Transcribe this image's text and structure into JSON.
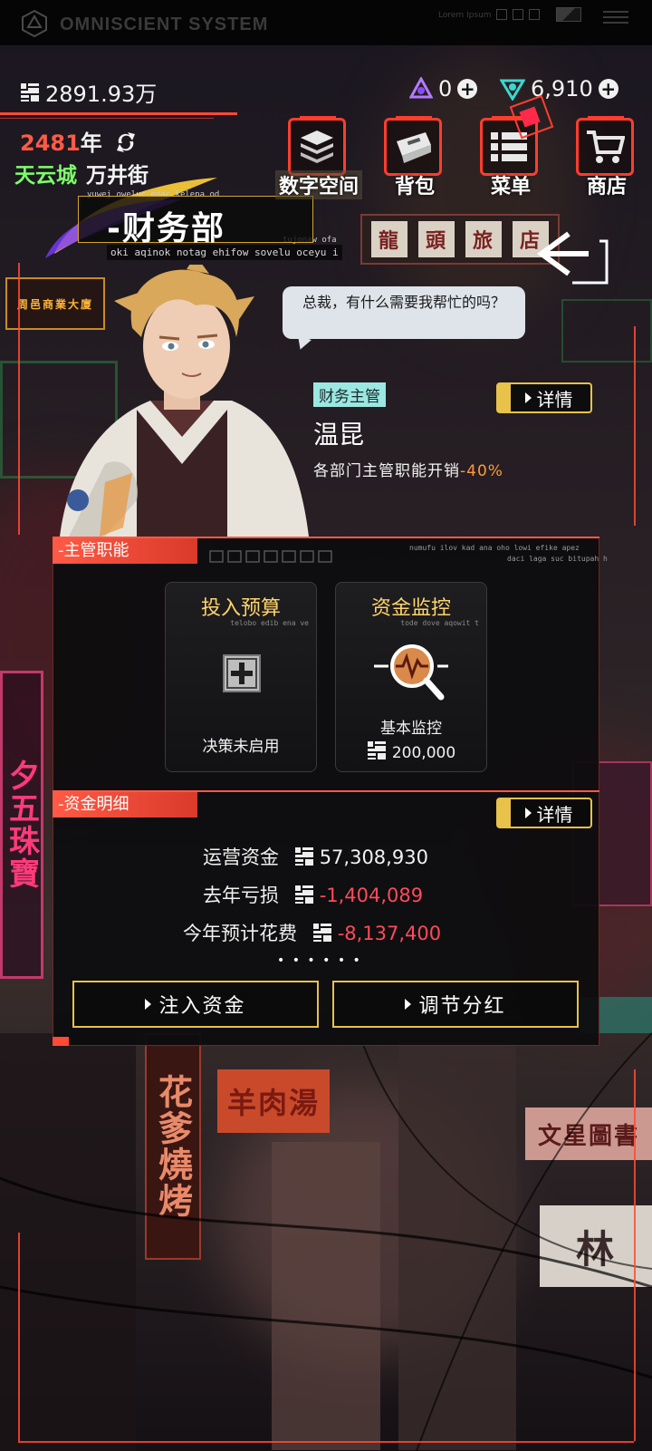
{
  "system": {
    "title": "OMNISCIENT SYSTEM",
    "lorem": "Lorem Ipsum"
  },
  "resources": {
    "money": "2891.93万",
    "gems_purple": "0",
    "gems_teal": "6,910"
  },
  "header": {
    "year_number": "2481",
    "year_unit": "年",
    "city": "天云城",
    "street": "万井街",
    "micro_top": "yuwej oweluc edac kelepa od",
    "micro_right": "tujonaw ofa",
    "department": "-财务部",
    "dept_sub": "oki aqinok notag ehifow sovelu oceyu i"
  },
  "menu": {
    "digital_space": "数字空间",
    "backpack": "背包",
    "menu": "菜单",
    "shop": "商店"
  },
  "signs": {
    "dragon": [
      "龍",
      "頭",
      "旅",
      "店"
    ],
    "mutton": "羊肉湯",
    "bookstore": "文星圖書",
    "bbq": "花爹燒烤",
    "left_vertical": "夕五珠寶",
    "left_top": "周邑商業大廈",
    "lin": "林"
  },
  "character": {
    "dialogue": "总裁，有什么需要我帮忙的吗？",
    "role": "财务主管",
    "name": "温昆",
    "effect_label": "各部门主管职能开销",
    "effect_value": "-40%",
    "detail_label": "详情"
  },
  "duties": {
    "tab": "-主管职能",
    "micro1": "numufu ilov kad ana oho lowi efike apez",
    "micro2": "daci laga suc bitupah h",
    "cards": [
      {
        "title": "投入预算",
        "sub": "telobo edib ena ve",
        "status": "决策未启用",
        "icon": "plus-box-icon"
      },
      {
        "title": "资金监控",
        "sub": "tode dove aqowit t",
        "status": "基本监控",
        "value": "200,000",
        "icon": "monitor-magnifier-icon"
      }
    ]
  },
  "funds": {
    "tab": "-资金明细",
    "detail_label": "详情",
    "rows": [
      {
        "label": "运营资金",
        "value": "57,308,930"
      },
      {
        "label": "去年亏损",
        "value": "-1,404,089"
      },
      {
        "label": "今年预计花费",
        "value": "-8,137,400"
      }
    ],
    "dots": "• • • • • •",
    "inject_label": "注入资金",
    "dividend_label": "调节分红"
  },
  "colors": {
    "accent_red": "#ff5a45",
    "accent_gold": "#e8c24a",
    "city_green": "#7dff6a",
    "negative": "#ff4a5a"
  }
}
